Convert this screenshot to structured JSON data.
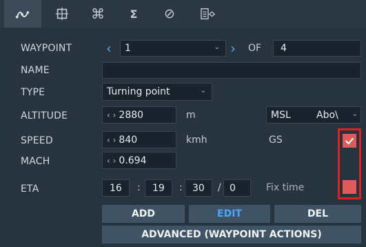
{
  "tabs": [
    {
      "name": "route-icon",
      "label": "ᨒ"
    },
    {
      "name": "target-box-icon",
      "label": "⌘"
    },
    {
      "name": "command-icon",
      "label": "⌘"
    },
    {
      "name": "sigma-icon",
      "label": "Σ"
    },
    {
      "name": "null-icon",
      "label": "⊘"
    },
    {
      "name": "list-settings-icon",
      "label": "▤⋄"
    }
  ],
  "rows": {
    "waypoint": {
      "label": "WAYPOINT",
      "value": "1",
      "of_label": "OF",
      "total": "4"
    },
    "name": {
      "label": "NAME",
      "value": ""
    },
    "type": {
      "label": "TYPE",
      "value": "Turning point"
    },
    "altitude": {
      "label": "ALTITUDE",
      "value": "2880",
      "unit": "m",
      "reference": "MSL",
      "mode": "Abo\\"
    },
    "speed": {
      "label": "SPEED",
      "value": "840",
      "unit": "kmh",
      "reference": "GS"
    },
    "mach": {
      "label": "MACH",
      "value": "0.694"
    },
    "eta": {
      "label": "ETA",
      "hours": "16",
      "minutes": "19",
      "seconds": "30",
      "frames": "0",
      "sep1": ":",
      "sep2": ":",
      "sep3": "/",
      "fix_label": "Fix time"
    }
  },
  "buttons": {
    "add": "ADD",
    "edit": "EDIT",
    "del": "DEL",
    "advanced": "ADVANCED (WAYPOINT ACTIONS)"
  },
  "checkboxes": {
    "gs_checked": true,
    "fix_time_checked": false
  },
  "colors": {
    "accent": "#4aa7ff",
    "highlight": "#e02020",
    "checkbox": "#e05a5a"
  }
}
